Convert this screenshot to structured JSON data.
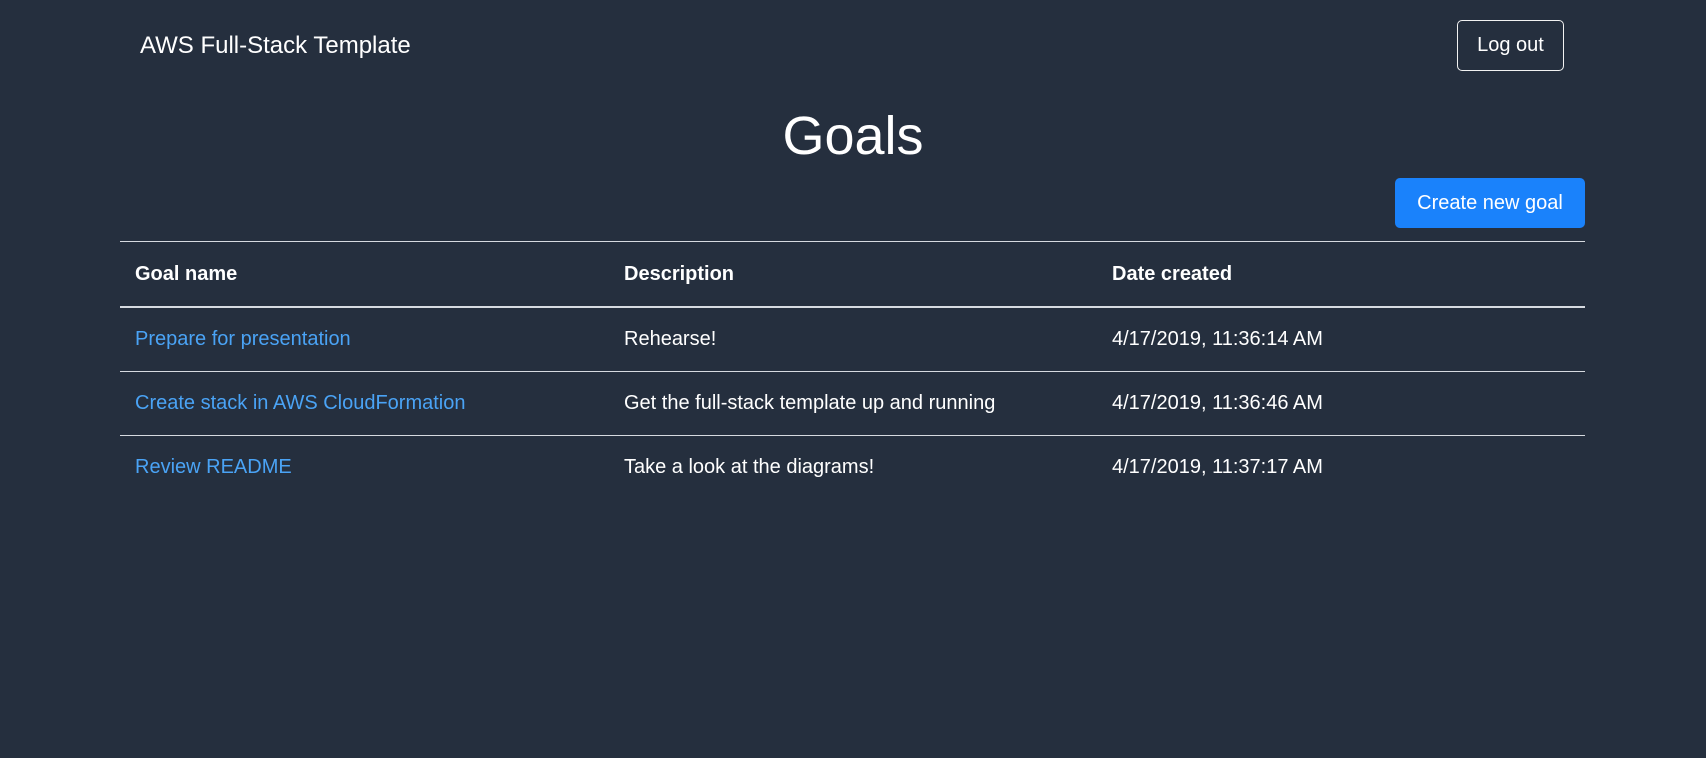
{
  "navbar": {
    "brand": "AWS Full-Stack Template",
    "logout_label": "Log out"
  },
  "page": {
    "title": "Goals",
    "create_button_label": "Create new goal"
  },
  "table": {
    "headers": [
      "Goal name",
      "Description",
      "Date created"
    ],
    "rows": [
      {
        "name": "Prepare for presentation",
        "description": "Rehearse!",
        "date": "4/17/2019, 11:36:14 AM"
      },
      {
        "name": "Create stack in AWS CloudFormation",
        "description": "Get the full-stack template up and running",
        "date": "4/17/2019, 11:36:46 AM"
      },
      {
        "name": "Review README",
        "description": "Take a look at the diagrams!",
        "date": "4/17/2019, 11:37:17 AM"
      }
    ]
  },
  "colors": {
    "background": "#252f3e",
    "primary_button": "#1a82fb",
    "link": "#4aa3f5",
    "text": "#ffffff"
  }
}
